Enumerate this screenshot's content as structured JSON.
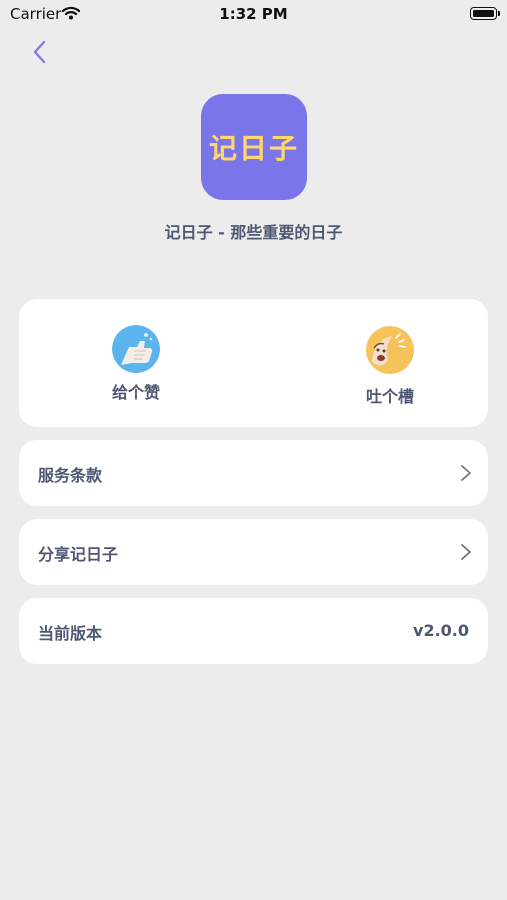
{
  "status_bar": {
    "carrier": "Carrier",
    "time": "1:32 PM",
    "icons": [
      "wifi-icon",
      "battery-icon"
    ]
  },
  "nav": {
    "back_icon": "chevron-left-icon"
  },
  "app": {
    "icon_text": "记日子",
    "subtitle": "记日子 - 那些重要的日子",
    "icon_color": "#7b75ea",
    "icon_text_color": "#ffd76b"
  },
  "actions": [
    {
      "label": "给个赞",
      "icon": "thumbs-up-icon"
    },
    {
      "label": "吐个槽",
      "icon": "complain-face-icon"
    }
  ],
  "menu": {
    "terms": "服务条款",
    "share": "分享记日子",
    "version_label": "当前版本",
    "version_value": "v2.0.0"
  },
  "colors": {
    "background": "#ececec",
    "card": "#ffffff",
    "text": "#4f5872",
    "accent": "#7b75ea"
  }
}
